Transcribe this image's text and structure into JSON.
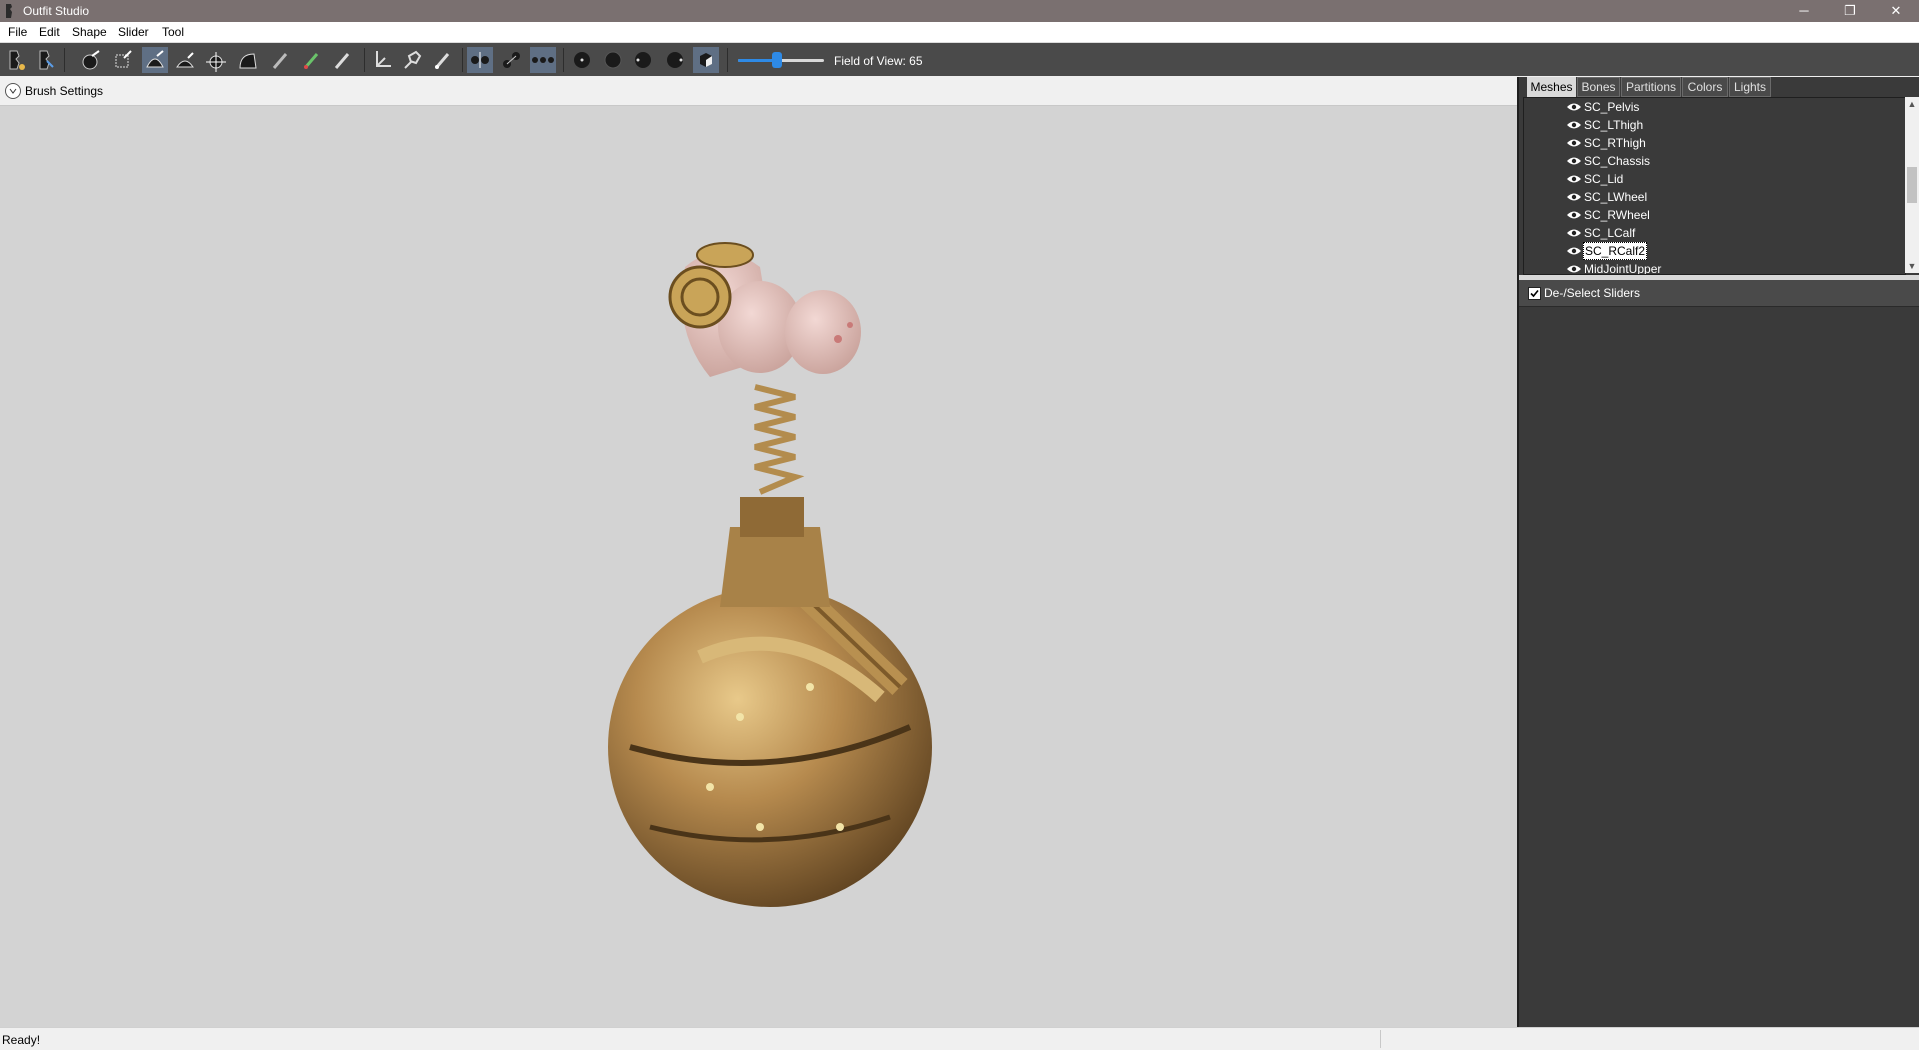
{
  "window": {
    "title": "Outfit Studio",
    "controls": {
      "minimize": "─",
      "restore": "❐",
      "close": "✕"
    }
  },
  "menu": {
    "items": [
      "File",
      "Edit",
      "Shape",
      "Slider",
      "Tool"
    ]
  },
  "toolbar": {
    "fov_label": "Field of View: 65",
    "fov_value": 65,
    "fov_fraction": 0.45,
    "tools": [
      {
        "name": "load-reference-icon"
      },
      {
        "name": "load-outfit-icon"
      },
      {
        "name": "select-brush-icon"
      },
      {
        "name": "mask-brush-icon"
      },
      {
        "name": "inflate-brush-icon"
      },
      {
        "name": "deflate-brush-icon"
      },
      {
        "name": "move-brush-icon"
      },
      {
        "name": "smooth-brush-icon"
      },
      {
        "name": "weight-brush-icon"
      },
      {
        "name": "color-brush-icon"
      },
      {
        "name": "alpha-brush-icon"
      },
      {
        "name": "transform-icon"
      },
      {
        "name": "pivot-icon"
      },
      {
        "name": "vertex-edit-icon"
      },
      {
        "name": "x-mirror-icon",
        "active": true
      },
      {
        "name": "connected-only-icon"
      },
      {
        "name": "global-brush-icon",
        "active": true
      },
      {
        "name": "small-brush-icon"
      },
      {
        "name": "large-brush-icon"
      },
      {
        "name": "dot-brush-icon"
      },
      {
        "name": "sphere-brush-icon"
      },
      {
        "name": "cube-icon",
        "active": true
      }
    ]
  },
  "viewport": {
    "brush_settings_label": "Brush Settings",
    "background": "#d3d3d3"
  },
  "right_panel": {
    "tabs": [
      {
        "label": "Meshes",
        "active": true
      },
      {
        "label": "Bones"
      },
      {
        "label": "Partitions"
      },
      {
        "label": "Colors"
      },
      {
        "label": "Lights"
      }
    ],
    "meshes": [
      {
        "label": "SC_Pelvis"
      },
      {
        "label": "SC_LThigh"
      },
      {
        "label": "SC_RThigh"
      },
      {
        "label": "SC_Chassis"
      },
      {
        "label": "SC_Lid"
      },
      {
        "label": "SC_LWheel"
      },
      {
        "label": "SC_RWheel"
      },
      {
        "label": "SC_LCalf"
      },
      {
        "label": "SC_RCalf2",
        "selected": true
      },
      {
        "label": "MidJointUpper"
      }
    ],
    "sliders_header": "De-/Select Sliders",
    "sliders_checked": true
  },
  "status": {
    "text": "Ready!"
  },
  "colors": {
    "accent": "#2e8ae6",
    "toolbar_bg": "#4a4a4a",
    "panel_bg": "#3a3a3a",
    "title_bg": "#7a7070"
  }
}
